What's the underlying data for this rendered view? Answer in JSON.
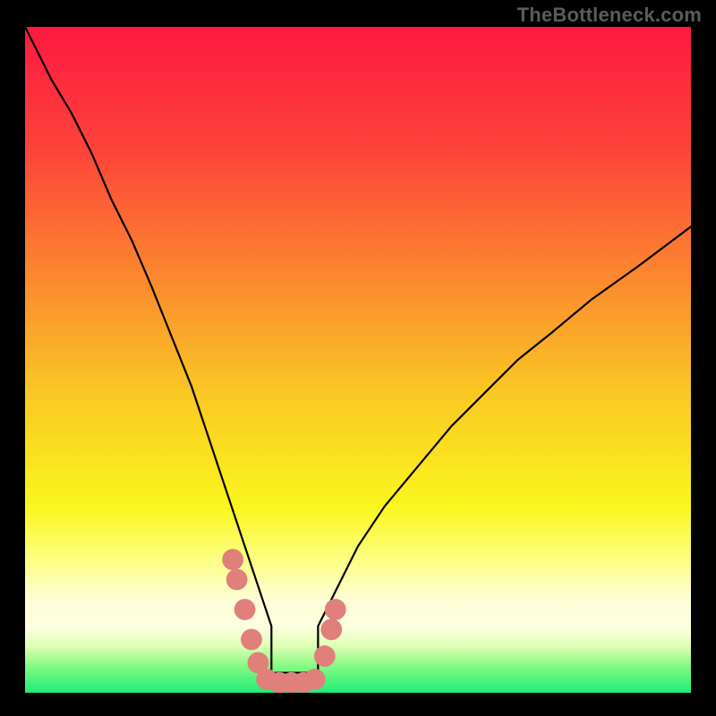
{
  "watermark": "TheBottleneck.com",
  "chart_data": {
    "type": "line",
    "title": "",
    "xlabel": "",
    "ylabel": "",
    "xlim": [
      0,
      100
    ],
    "ylim": [
      0,
      100
    ],
    "grid": false,
    "legend": false,
    "background_gradient": {
      "stops": [
        {
          "offset": 0.0,
          "color": "#fe1940"
        },
        {
          "offset": 0.18,
          "color": "#fd423a"
        },
        {
          "offset": 0.38,
          "color": "#fb8a2e"
        },
        {
          "offset": 0.55,
          "color": "#fac824"
        },
        {
          "offset": 0.72,
          "color": "#faf61e"
        },
        {
          "offset": 0.8,
          "color": "#fdff82"
        },
        {
          "offset": 0.86,
          "color": "#fefed6"
        },
        {
          "offset": 0.9,
          "color": "#feffe1"
        },
        {
          "offset": 0.93,
          "color": "#dfffb5"
        },
        {
          "offset": 0.96,
          "color": "#85fa81"
        },
        {
          "offset": 1.0,
          "color": "#1cee77"
        }
      ]
    },
    "series": [
      {
        "name": "bottleneck-curve",
        "color": "#000000",
        "x": [
          0,
          2,
          4,
          7,
          10,
          13,
          16,
          19,
          21,
          23,
          25,
          27,
          29,
          31,
          33,
          35,
          37,
          37,
          44,
          44,
          46,
          48,
          50,
          54,
          59,
          64,
          69,
          74,
          79,
          85,
          92,
          100
        ],
        "y": [
          100,
          96,
          92,
          87,
          81,
          74,
          68,
          61,
          56,
          51,
          46,
          40,
          34,
          28,
          22,
          16,
          10,
          3,
          3,
          10,
          14,
          18,
          22,
          28,
          34,
          40,
          45,
          50,
          54,
          59,
          64,
          70
        ]
      }
    ],
    "markers": {
      "name": "highlight-dots",
      "color": "#e17f7a",
      "radius": 1.6,
      "points": [
        {
          "x": 31.2,
          "y": 20.0
        },
        {
          "x": 31.8,
          "y": 17.0
        },
        {
          "x": 33.0,
          "y": 12.5
        },
        {
          "x": 34.0,
          "y": 8.0
        },
        {
          "x": 35.0,
          "y": 4.5
        },
        {
          "x": 36.3,
          "y": 2.0
        },
        {
          "x": 38.2,
          "y": 1.5
        },
        {
          "x": 40.0,
          "y": 1.5
        },
        {
          "x": 41.8,
          "y": 1.5
        },
        {
          "x": 43.5,
          "y": 2.0
        },
        {
          "x": 45.0,
          "y": 5.5
        },
        {
          "x": 46.0,
          "y": 9.5
        },
        {
          "x": 46.6,
          "y": 12.5
        }
      ]
    }
  }
}
